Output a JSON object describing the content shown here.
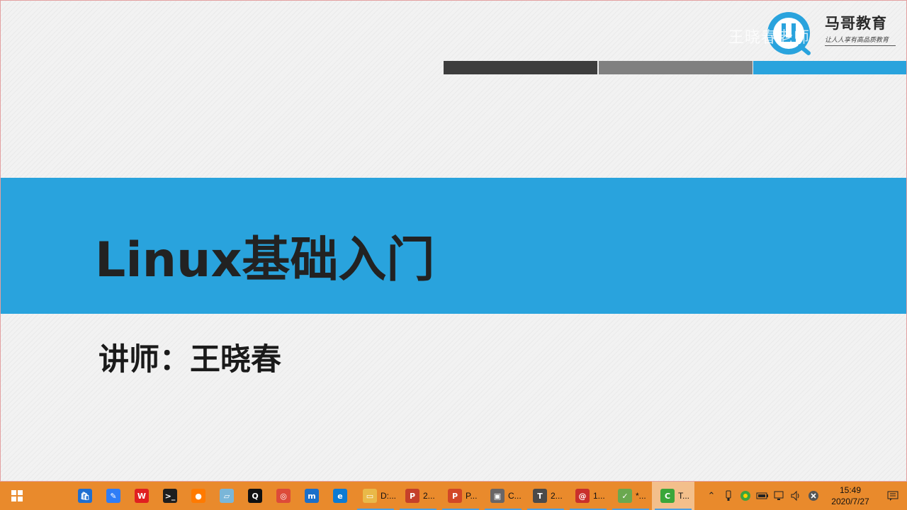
{
  "colors": {
    "accent_blue": "#29a3dd",
    "bar_dark": "#3d3d3d",
    "bar_gray": "#808080",
    "taskbar_bg": "#e98a2c"
  },
  "slide": {
    "title": "Linux基础入门",
    "lecturer": "讲师：王晓春",
    "watermark": "王晓春老师",
    "brand": {
      "name": "马哥教育",
      "slogan": "让人人享有高品质教育"
    }
  },
  "taskbar": {
    "pinned": [
      {
        "name": "store-icon"
      },
      {
        "name": "feishu-icon"
      },
      {
        "name": "wps-icon"
      },
      {
        "name": "terminal-icon"
      },
      {
        "name": "photos-icon"
      },
      {
        "name": "notes-icon"
      },
      {
        "name": "qq-icon"
      },
      {
        "name": "chrome-icon"
      },
      {
        "name": "maxthon-icon"
      },
      {
        "name": "edge-icon"
      }
    ],
    "apps": [
      {
        "label": "D:...",
        "icon": "folder-icon",
        "open": true
      },
      {
        "label": "2...",
        "icon": "powerpoint-icon",
        "open": true
      },
      {
        "label": "P...",
        "icon": "powerpoint-doc-icon",
        "open": true
      },
      {
        "label": "C...",
        "icon": "vmware-icon",
        "open": true
      },
      {
        "label": "2...",
        "icon": "typora-icon",
        "open": true
      },
      {
        "label": "1...",
        "icon": "snail-icon",
        "open": true
      },
      {
        "label": "*...",
        "icon": "notepad-icon",
        "open": true
      },
      {
        "label": "T...",
        "icon": "camtasia-icon",
        "open": true
      }
    ],
    "clock": {
      "time": "15:49",
      "date": "2020/7/27"
    }
  }
}
